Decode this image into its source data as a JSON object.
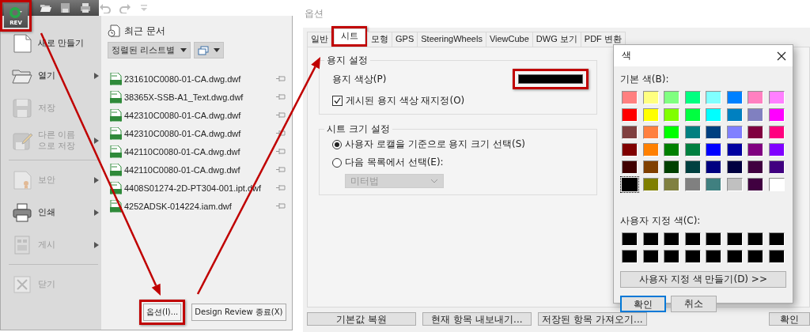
{
  "app_button": {
    "label": "REV",
    "highlighted": true
  },
  "app_menu": {
    "groups": [
      [
        {
          "kind": "new",
          "label": "새로 만들기",
          "disabled": false,
          "submenu": false
        },
        {
          "kind": "open",
          "label": "열기",
          "disabled": false,
          "submenu": true
        },
        {
          "kind": "save",
          "label": "저장",
          "disabled": true,
          "submenu": false
        },
        {
          "kind": "save_as",
          "label": "다른 이름 으로 저장",
          "disabled": true,
          "submenu": true
        }
      ],
      [
        {
          "kind": "security",
          "label": "보안",
          "disabled": true,
          "submenu": true
        },
        {
          "kind": "print",
          "label": "인쇄",
          "disabled": false,
          "submenu": true
        },
        {
          "kind": "publish",
          "label": "게시",
          "disabled": true,
          "submenu": true
        }
      ],
      [
        {
          "kind": "close",
          "label": "닫기",
          "disabled": true,
          "submenu": false
        }
      ]
    ]
  },
  "recent_documents": {
    "title": "최근 문서",
    "sort_dropdown": "정렬된 리스트별",
    "files": [
      {
        "name": "231610C0080-01-CA.dwg.dwf"
      },
      {
        "name": "38365X-SSB-A1_Text.dwg.dwf"
      },
      {
        "name": "442310C0080-01-CA.dwg.dwf"
      },
      {
        "name": "442310C0080-01-CA.dwg.dwf"
      },
      {
        "name": "442110C0080-01-CA.dwg.dwf"
      },
      {
        "name": "442110C0080-01-CA.dwg.dwf"
      },
      {
        "name": "4408S01274-2D-PT304-001.ipt.dwf"
      },
      {
        "name": "4252ADSK-014224.iam.dwf"
      }
    ]
  },
  "menu_buttons": [
    {
      "label": "옵션(I)...",
      "highlighted": true
    },
    {
      "label": "Design Review 종료(X)",
      "highlighted": false
    }
  ],
  "options_dialog": {
    "title": "옵션",
    "tabs": [
      {
        "label": "일반",
        "selected": false,
        "highlighted": false
      },
      {
        "label": "시트",
        "selected": true,
        "highlighted": true
      },
      {
        "label": "모형",
        "selected": false,
        "highlighted": false
      },
      {
        "label": "GPS",
        "selected": false,
        "highlighted": false
      },
      {
        "label": "SteeringWheels",
        "selected": false,
        "highlighted": false
      },
      {
        "label": "ViewCube",
        "selected": false,
        "highlighted": false
      },
      {
        "label": "DWG 보기",
        "selected": false,
        "highlighted": false
      },
      {
        "label": "PDF 변환",
        "selected": false,
        "highlighted": false
      }
    ],
    "paper_settings": {
      "title": "용지 설정",
      "color_label": "용지 색상(P)",
      "color": "#000000",
      "color_highlighted": true,
      "override_checkbox": {
        "label": "게시된 용지 색상 재지정(O)",
        "checked": true
      }
    },
    "sheet_size": {
      "title": "시트 크기 설정",
      "options": [
        {
          "label": "사용자 로캘을 기준으로 용지 크기 선택(S)",
          "selected": true
        },
        {
          "label": "다음 목록에서 선택(E):",
          "selected": false
        }
      ],
      "dropdown": {
        "value": "미터법",
        "disabled": true
      }
    },
    "buttons": [
      "기본값 복원",
      "현재 항목 내보내기...",
      "저장된 항목 가져오기...",
      "확인"
    ]
  },
  "color_dialog": {
    "title": "색",
    "basic_label": "기본 색(B):",
    "basic_colors": [
      {
        "color": "#ff8080",
        "selected": false
      },
      {
        "color": "#ffff80",
        "selected": false
      },
      {
        "color": "#80ff80",
        "selected": false
      },
      {
        "color": "#00ff80",
        "selected": false
      },
      {
        "color": "#80ffff",
        "selected": false
      },
      {
        "color": "#0080ff",
        "selected": false
      },
      {
        "color": "#ff80c0",
        "selected": false
      },
      {
        "color": "#ff80ff",
        "selected": false
      },
      {
        "color": "#ff0000",
        "selected": false
      },
      {
        "color": "#ffff00",
        "selected": false
      },
      {
        "color": "#80ff00",
        "selected": false
      },
      {
        "color": "#00ff40",
        "selected": false
      },
      {
        "color": "#00ffff",
        "selected": false
      },
      {
        "color": "#0080c0",
        "selected": false
      },
      {
        "color": "#8080c0",
        "selected": false
      },
      {
        "color": "#ff00ff",
        "selected": false
      },
      {
        "color": "#804040",
        "selected": false
      },
      {
        "color": "#ff8040",
        "selected": false
      },
      {
        "color": "#00ff00",
        "selected": false
      },
      {
        "color": "#008080",
        "selected": false
      },
      {
        "color": "#004080",
        "selected": false
      },
      {
        "color": "#8080ff",
        "selected": false
      },
      {
        "color": "#800040",
        "selected": false
      },
      {
        "color": "#ff0080",
        "selected": false
      },
      {
        "color": "#800000",
        "selected": false
      },
      {
        "color": "#ff8000",
        "selected": false
      },
      {
        "color": "#008000",
        "selected": false
      },
      {
        "color": "#008040",
        "selected": false
      },
      {
        "color": "#0000ff",
        "selected": false
      },
      {
        "color": "#0000a0",
        "selected": false
      },
      {
        "color": "#800080",
        "selected": false
      },
      {
        "color": "#8000ff",
        "selected": false
      },
      {
        "color": "#400000",
        "selected": false
      },
      {
        "color": "#804000",
        "selected": false
      },
      {
        "color": "#004000",
        "selected": false
      },
      {
        "color": "#004040",
        "selected": false
      },
      {
        "color": "#000080",
        "selected": false
      },
      {
        "color": "#000040",
        "selected": false
      },
      {
        "color": "#400040",
        "selected": false
      },
      {
        "color": "#400080",
        "selected": false
      },
      {
        "color": "#000000",
        "selected": true
      },
      {
        "color": "#808000",
        "selected": false
      },
      {
        "color": "#808040",
        "selected": false
      },
      {
        "color": "#808080",
        "selected": false
      },
      {
        "color": "#408080",
        "selected": false
      },
      {
        "color": "#c0c0c0",
        "selected": false
      },
      {
        "color": "#400040",
        "selected": false
      },
      {
        "color": "#ffffff",
        "selected": false
      }
    ],
    "custom_label": "사용자 지정 색(C):",
    "custom_colors": [
      {
        "color": "#000000"
      },
      {
        "color": "#000000"
      },
      {
        "color": "#000000"
      },
      {
        "color": "#000000"
      },
      {
        "color": "#000000"
      },
      {
        "color": "#000000"
      },
      {
        "color": "#000000"
      },
      {
        "color": "#000000"
      },
      {
        "color": "#000000"
      },
      {
        "color": "#000000"
      },
      {
        "color": "#000000"
      },
      {
        "color": "#000000"
      },
      {
        "color": "#000000"
      },
      {
        "color": "#000000"
      },
      {
        "color": "#000000"
      },
      {
        "color": "#000000"
      }
    ],
    "define_button": "사용자 지정 색 만들기(D) >>",
    "buttons": [
      {
        "label": "확인",
        "default": true
      },
      {
        "label": "취소",
        "default": false
      }
    ]
  }
}
